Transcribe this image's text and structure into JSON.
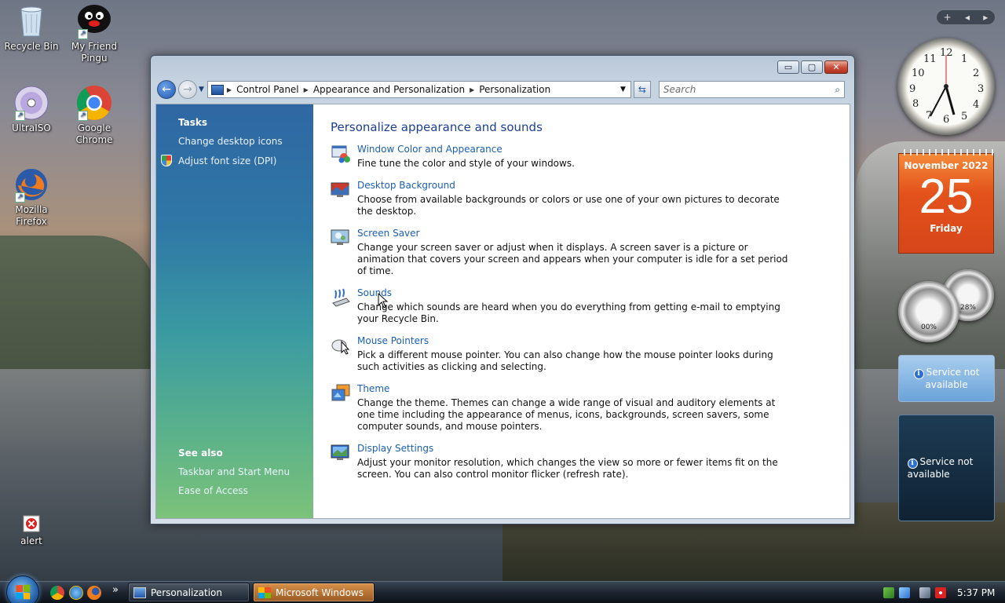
{
  "desktop_icons": [
    {
      "label": "Recycle Bin",
      "icon": "recycle-bin-icon"
    },
    {
      "label": "My Friend Pingu",
      "icon": "pingu-icon"
    },
    {
      "label": "UltraISO",
      "icon": "disc-icon"
    },
    {
      "label": "Google Chrome",
      "icon": "chrome-icon"
    },
    {
      "label": "Mozilla Firefox",
      "icon": "firefox-icon"
    },
    {
      "label": "alert",
      "icon": "alert-icon"
    }
  ],
  "window": {
    "controls": {
      "minimize": "▭",
      "maximize": "▢",
      "close": "✕"
    },
    "breadcrumb": [
      "Control Panel",
      "Appearance and Personalization",
      "Personalization"
    ],
    "search_placeholder": "Search",
    "tasks": {
      "heading": "Tasks",
      "items": [
        "Change desktop icons",
        "Adjust font size (DPI)"
      ]
    },
    "see_also": {
      "heading": "See also",
      "items": [
        "Taskbar and Start Menu",
        "Ease of Access"
      ]
    },
    "main": {
      "heading": "Personalize appearance and sounds",
      "items": [
        {
          "title": "Window Color and Appearance",
          "desc": "Fine tune the color and style of your windows.",
          "icon": "window-color-icon"
        },
        {
          "title": "Desktop Background",
          "desc": "Choose from available backgrounds or colors or use one of your own pictures to decorate the desktop.",
          "icon": "desktop-background-icon"
        },
        {
          "title": "Screen Saver",
          "desc": "Change your screen saver or adjust when it displays. A screen saver is a picture or animation that covers your screen and appears when your computer is idle for a set period of time.",
          "icon": "screen-saver-icon"
        },
        {
          "title": "Sounds",
          "desc": "Change which sounds are heard when you do everything from getting e-mail to emptying your Recycle Bin.",
          "icon": "sounds-icon"
        },
        {
          "title": "Mouse Pointers",
          "desc": "Pick a different mouse pointer. You can also change how the mouse pointer looks during such activities as clicking and selecting.",
          "icon": "mouse-icon"
        },
        {
          "title": "Theme",
          "desc": "Change the theme. Themes can change a wide range of visual and auditory elements at one time including the appearance of menus, icons, backgrounds, screen savers, some computer sounds, and mouse pointers.",
          "icon": "theme-icon"
        },
        {
          "title": "Display Settings",
          "desc": "Adjust your monitor resolution, which changes the view so more or fewer items fit on the screen. You can also control monitor flicker (refresh rate).",
          "icon": "display-settings-icon"
        }
      ]
    }
  },
  "gadgets": {
    "bar": {
      "add": "+",
      "prev": "◂",
      "next": "▸"
    },
    "clock_numbers": [
      "12",
      "1",
      "2",
      "3",
      "4",
      "5",
      "6",
      "7",
      "8",
      "9",
      "10",
      "11"
    ],
    "calendar": {
      "month": "November 2022",
      "day": "25",
      "weekday": "Friday"
    },
    "cpu_meter": {
      "cpu": "00%",
      "memory": "28%"
    },
    "service_1": "Service not available",
    "service_2": "Service not available"
  },
  "taskbar": {
    "tasks": [
      "Personalization",
      "Microsoft Windows"
    ],
    "overflow": "»",
    "time": "5:37 PM"
  },
  "colors": {
    "link": "#1a5fb4",
    "heading": "#1c3f8f",
    "taskpane_top": "#2f67a3",
    "taskpane_bottom": "#7cc27a",
    "calendar": "#e3521b"
  }
}
